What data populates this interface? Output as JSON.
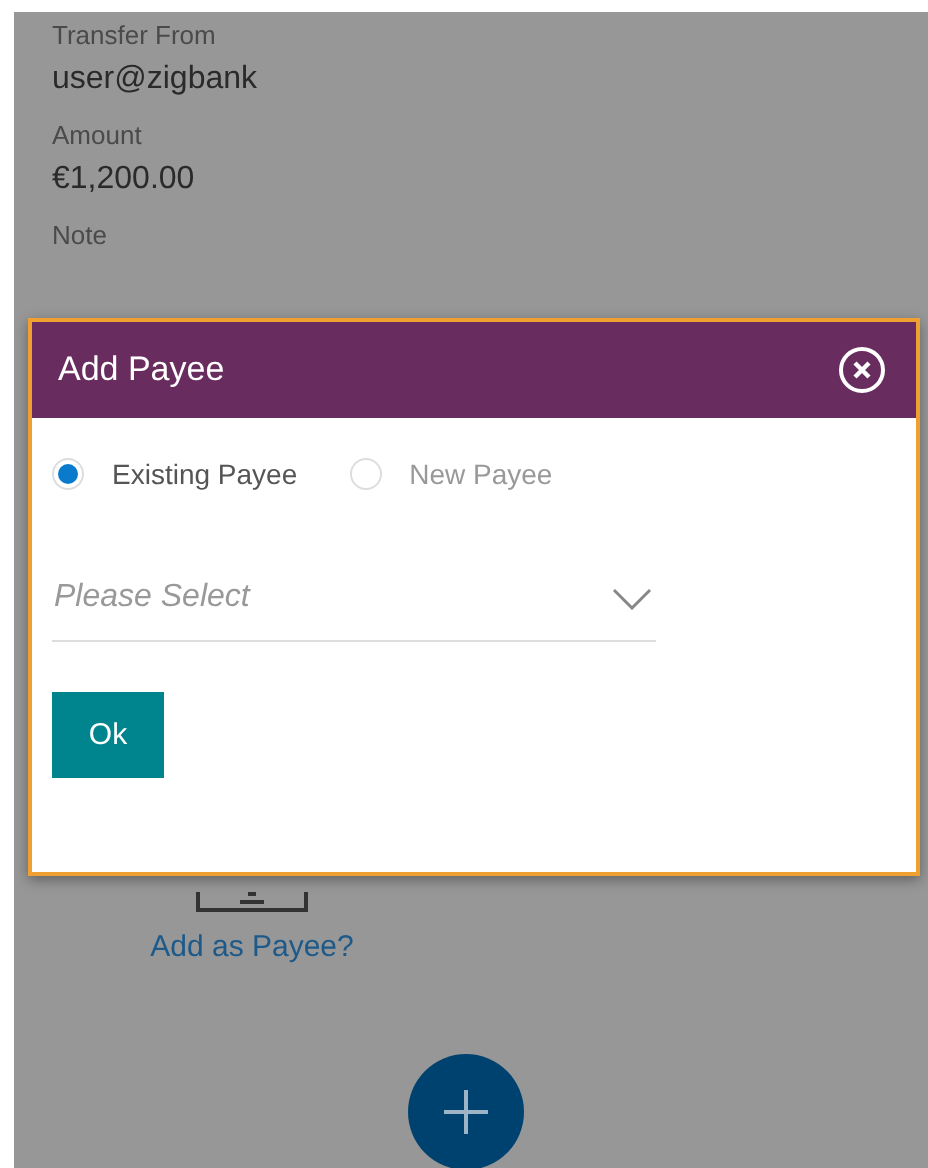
{
  "details": [
    {
      "label": "Transfer From",
      "value": "user@zigbank"
    },
    {
      "label": "Amount",
      "value": "€1,200.00"
    },
    {
      "label": "Note"
    }
  ],
  "add_payee_link": "Add as Payee?",
  "dialog": {
    "title": "Add Payee",
    "options": [
      {
        "label": "Existing Payee",
        "selected": true
      },
      {
        "label": "New Payee",
        "selected": false
      }
    ],
    "select": {
      "placeholder": "Please Select"
    },
    "button": "Ok"
  }
}
